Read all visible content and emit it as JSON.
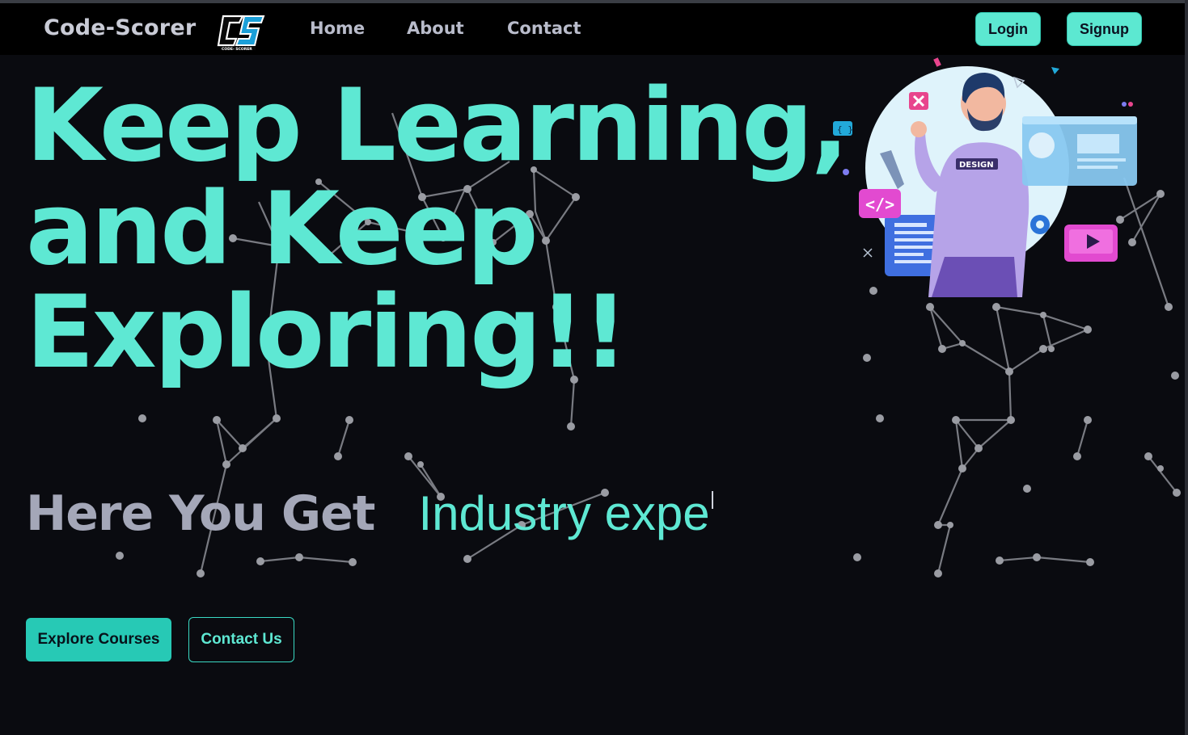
{
  "navbar": {
    "brand": "Code-Scorer",
    "logo_icon": "code-scorer-logo-icon",
    "links": [
      "Home",
      "About",
      "Contact"
    ],
    "login_label": "Login",
    "signup_label": "Signup"
  },
  "hero": {
    "title_lines": [
      "Keep Learning,",
      "and Keep",
      "Exploring!!"
    ],
    "subtitle_static": "Here You Get",
    "subtitle_typed": "Industry expe",
    "illustration": "designer-illustration-icon",
    "explore_label": "Explore Courses",
    "contact_label": "Contact Us"
  },
  "colors": {
    "accent": "#5ee8d3",
    "button": "#27c9b5",
    "background": "#0a0b10",
    "navbar": "#000000",
    "muted_text": "#a4a7b8"
  }
}
